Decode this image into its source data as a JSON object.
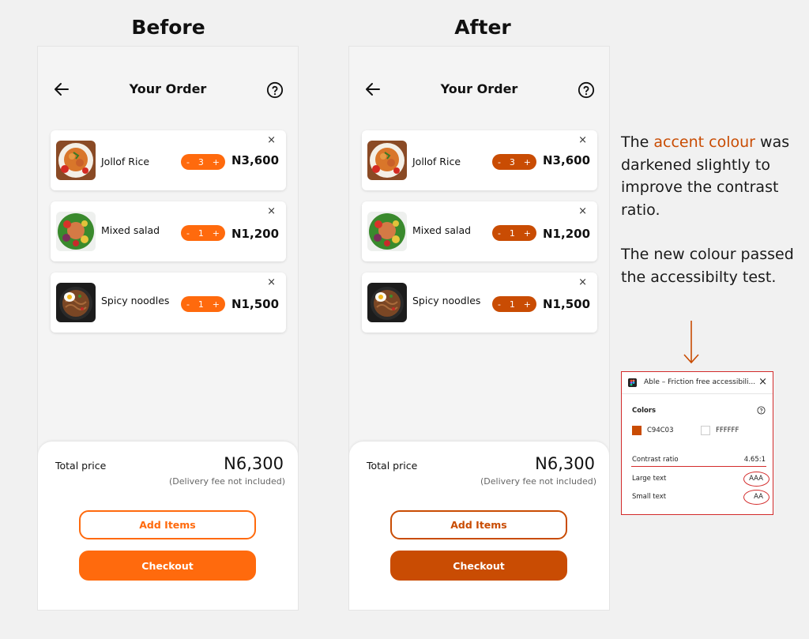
{
  "headings": {
    "before": "Before",
    "after": "After"
  },
  "colors": {
    "before_accent": "#FF6A0D",
    "after_accent": "#C94C03"
  },
  "screen": {
    "title": "Your Order",
    "back_icon": "arrow-left-icon",
    "help_icon": "help-circle-icon",
    "items": [
      {
        "name": "Jollof Rice",
        "qty": "3",
        "minus": "-",
        "plus": "+",
        "price": "N3,600",
        "remove": "×"
      },
      {
        "name": "Mixed salad",
        "qty": "1",
        "minus": "-",
        "plus": "+",
        "price": "N1,200",
        "remove": "×"
      },
      {
        "name": "Spicy noodles",
        "qty": "1",
        "minus": "-",
        "plus": "+",
        "price": "N1,500",
        "remove": "×"
      }
    ],
    "total_label": "Total price",
    "total_value": "N6,300",
    "fee_note": "(Delivery fee not included)",
    "add_items": "Add Items",
    "checkout": "Checkout"
  },
  "note": {
    "p1_pre": "The ",
    "p1_accent": "accent colour",
    "p1_post": " was darkened slightly to improve the contrast ratio.",
    "p2": "The new colour passed the accessibilty test."
  },
  "plugin": {
    "title": "Able – Friction free accessibili...",
    "close": "×",
    "colors_label": "Colors",
    "color1": "C94C03",
    "color2": "FFFFFF",
    "contrast_label": "Contrast ratio",
    "contrast_value": "4.65:1",
    "large_label": "Large text",
    "large_value": "AAA",
    "small_label": "Small text",
    "small_value": "AA"
  }
}
